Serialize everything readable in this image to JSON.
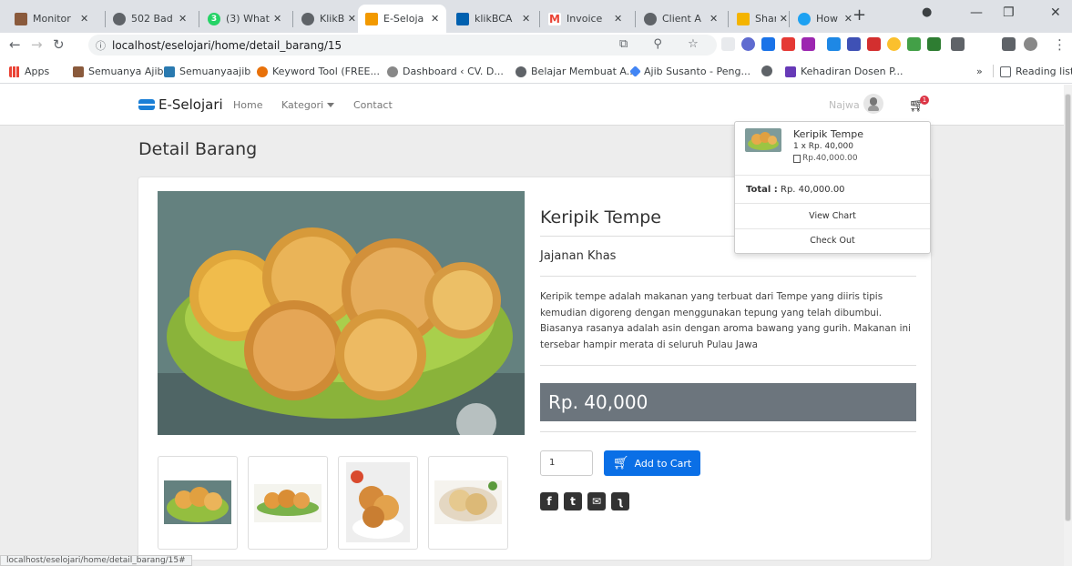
{
  "browser": {
    "tabs": [
      {
        "title": "Monitor",
        "fav_color": "#8a5a3c"
      },
      {
        "title": "502 Bad",
        "fav_color": "#5f6368"
      },
      {
        "title": "(3) What",
        "fav_color": "#25d366",
        "fav_text": "3"
      },
      {
        "title": "KlikBCA",
        "fav_color": "#5f6368"
      },
      {
        "title": "E-Seloja",
        "fav_color": "#f29900"
      },
      {
        "title": "klikBCA",
        "fav_color": "#0060af"
      },
      {
        "title": "Invoice",
        "fav_color": "#ea4335"
      },
      {
        "title": "Client A",
        "fav_color": "#5f6368"
      },
      {
        "title": "Sharing",
        "fav_color": "#f4b400"
      },
      {
        "title": "How to",
        "fav_color": "#1da1f2"
      }
    ],
    "active_tab_index": 4,
    "url": "localhost/eselojari/home/detail_barang/15",
    "bookmarks": [
      {
        "label": "Apps",
        "color": "#4285f4"
      },
      {
        "label": "Semuanya Ajib",
        "color": "#8a5a3c"
      },
      {
        "label": "Semuanyaajib",
        "color": "#2a7ab0"
      },
      {
        "label": "Keyword Tool (FREE...",
        "color": "#e8710a"
      },
      {
        "label": "Dashboard ‹ CV. D...",
        "color": "#888888"
      },
      {
        "label": "Belajar Membuat A...",
        "color": "#5f6368"
      },
      {
        "label": "Ajib Susanto - Peng...",
        "color": "#4285f4"
      },
      {
        "label": "",
        "color": "#5f6368"
      },
      {
        "label": "Kehadiran Dosen P...",
        "color": "#673ab7"
      }
    ],
    "more_bookmarks": "»",
    "reading_list": "Reading list",
    "status_url": "localhost/eselojari/home/detail_barang/15#"
  },
  "navbar": {
    "brand": "E-Selojari",
    "links": [
      "Home",
      "Kategori",
      "Contact"
    ],
    "user": "Najwa",
    "cart_count": "1"
  },
  "page_title": "Detail Barang",
  "product": {
    "name": "Keripik Tempe",
    "category": "Jajanan Khas",
    "description": "Keripik tempe adalah makanan yang terbuat dari Tempe yang diiris tipis kemudian digoreng dengan menggunakan tepung yang telah dibumbui. Biasanya rasanya adalah asin dengan aroma bawang yang gurih. Makanan ini tersebar hampir merata di seluruh Pulau Jawa",
    "price": "Rp. 40,000",
    "quantity": "1",
    "add_to_cart": "Add to Cart"
  },
  "cart_dropdown": {
    "item_name": "Keripik Tempe",
    "item_qty": "1 x Rp. 40,000",
    "item_subtotal": "Rp.40,000.00",
    "total_label": "Total :",
    "total_value": "Rp. 40,000.00",
    "view_chart": "View Chart",
    "check_out": "Check Out"
  },
  "colors": {
    "primary": "#0a6fe6",
    "price_bg": "#6c757d",
    "badge": "#dc3545"
  }
}
